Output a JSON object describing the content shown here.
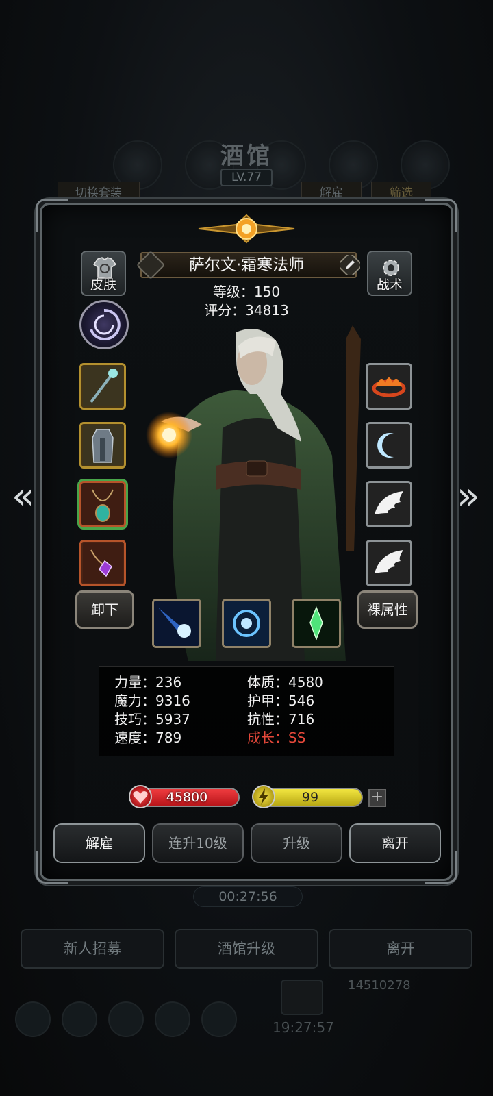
{
  "background": {
    "title": "酒馆",
    "level": "LV.77",
    "switch_outfit": "切换套装",
    "dismiss": "解雇",
    "filter": "筛选",
    "timer": "00:27:56",
    "bottom_buttons": [
      "新人招募",
      "酒馆升级",
      "离开"
    ],
    "gold": "14510278",
    "clock": "19:27:57"
  },
  "hero": {
    "name": "萨尔文·霜寒法师",
    "level_text": "等级：150",
    "score_text": "评分：34813",
    "skin_label": "皮肤",
    "tactic_label": "战术"
  },
  "equipment": {
    "left": [
      "staff",
      "robe",
      "amulet-necklace",
      "gem-pendant"
    ],
    "right": [
      "flame-crown",
      "moon-charm",
      "wing-feather",
      "wing-feather"
    ]
  },
  "skill_row": {
    "unequip": "卸下",
    "base_attributes": "裸属性",
    "skills": [
      "ice-comet",
      "frost-orb",
      "emerald-crystal"
    ]
  },
  "stats": {
    "strength": "力量：236",
    "constitution": "体质：4580",
    "magic": "魔力：9316",
    "armor": "护甲：546",
    "skill": "技巧：5937",
    "resistance": "抗性：716",
    "speed": "速度：789",
    "growth": "成长：SS"
  },
  "resources": {
    "hp": "45800",
    "energy": "99",
    "plus": "+"
  },
  "actions": {
    "dismiss": "解雇",
    "level_up_10": "连升10级",
    "level_up": "升级",
    "leave": "离开"
  },
  "nav": {
    "prev": "«",
    "next": "»"
  },
  "colors": {
    "hp": "#d6262b",
    "energy": "#e3d332",
    "growth": "#e5483a",
    "gold_frame": "#b3902f"
  }
}
